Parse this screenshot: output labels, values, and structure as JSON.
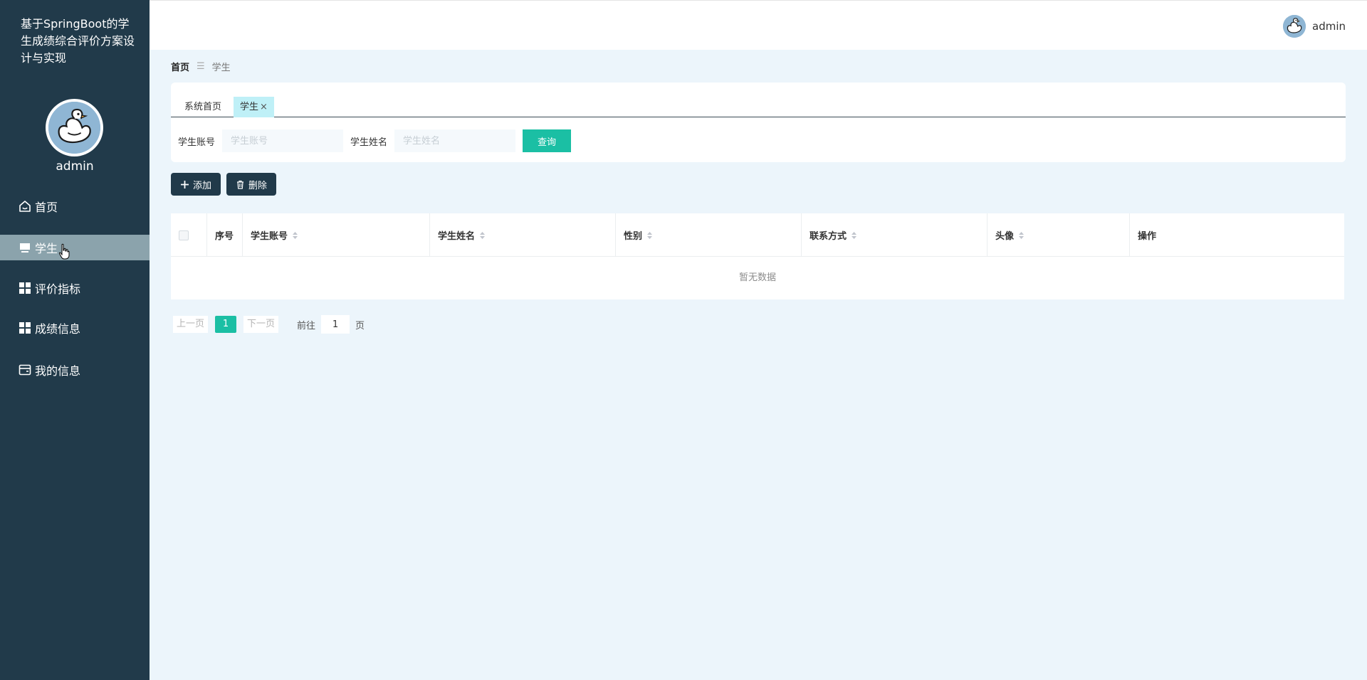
{
  "app": {
    "title": "基于SpringBoot的学生成绩综合评价方案设计与实现"
  },
  "sidebar": {
    "username": "admin",
    "items": [
      {
        "label": "首页",
        "icon": "home-icon"
      },
      {
        "label": "学生",
        "icon": "card-icon",
        "active": true
      },
      {
        "label": "评价指标",
        "icon": "grid-icon"
      },
      {
        "label": "成绩信息",
        "icon": "grid-icon"
      },
      {
        "label": "我的信息",
        "icon": "wallet-icon"
      }
    ]
  },
  "header": {
    "username": "admin"
  },
  "breadcrumb": {
    "home": "首页",
    "separator": "☰",
    "current": "学生"
  },
  "tabs": [
    {
      "label": "系统首页"
    },
    {
      "label": "学生",
      "close": "×"
    }
  ],
  "search": {
    "account_label": "学生账号",
    "account_placeholder": "学生账号",
    "name_label": "学生姓名",
    "name_placeholder": "学生姓名",
    "query_button": "查询"
  },
  "actions": {
    "add": "添加",
    "delete": "删除"
  },
  "table": {
    "columns": [
      "序号",
      "学生账号",
      "学生姓名",
      "性别",
      "联系方式",
      "头像",
      "操作"
    ],
    "empty_text": "暂无数据"
  },
  "pagination": {
    "prev": "上一页",
    "current_page": "1",
    "next": "下一页",
    "goto_label": "前往",
    "goto_value": "1",
    "page_unit": "页"
  },
  "colors": {
    "sidebar_bg": "#213a4a",
    "sidebar_active": "#8ba3ac",
    "accent": "#1bbfa4",
    "page_bg": "#ecf5fb"
  }
}
